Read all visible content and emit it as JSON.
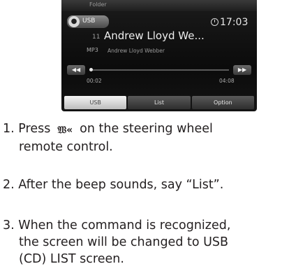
{
  "screen": {
    "folder_label": "Folder",
    "source_badge": "USB",
    "clock": "17:03",
    "track_number": "11",
    "track_title": "Andrew Lloyd We...",
    "format": "MP3",
    "artist": "Andrew Lloyd Webber",
    "elapsed": "00:02",
    "total": "04:08",
    "progress_fraction": 0.008,
    "rewind_icon": "rewind-icon",
    "forward_icon": "fast-forward-icon",
    "tabs": [
      {
        "label": "USB",
        "active": true
      },
      {
        "label": "List",
        "active": false
      },
      {
        "label": "Option",
        "active": false
      }
    ]
  },
  "steps": [
    {
      "part_a": "1. Press",
      "icon": "voice-command-icon",
      "part_b": "on the steering wheel",
      "line2": "remote control."
    },
    {
      "line1": "2. After the beep sounds, say “List”."
    },
    {
      "line1": "3. When the command is recognized,",
      "line2": "the screen will be changed to USB",
      "line3": "(CD) LIST screen."
    }
  ]
}
